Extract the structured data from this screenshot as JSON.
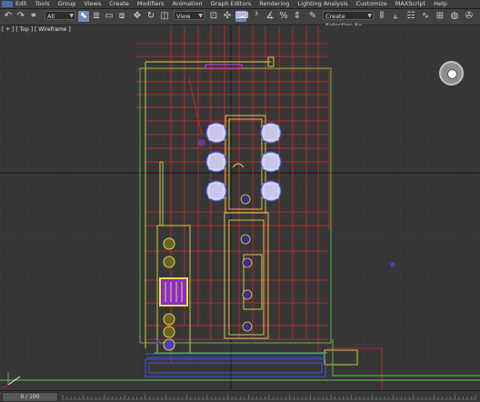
{
  "menu": {
    "items": [
      "Edit",
      "Tools",
      "Group",
      "Views",
      "Create",
      "Modifiers",
      "Animation",
      "Graph Editors",
      "Rendering",
      "Lighting Analysis",
      "Customize",
      "MAXScript",
      "Help"
    ]
  },
  "toolbar": {
    "filter_value": "All",
    "coord_value": "View",
    "selection_set_placeholder": "Create Selection Se"
  },
  "viewport": {
    "label": "[ + ] [ Top ] [ Wireframe ]"
  },
  "statusbar": {
    "frame_counter": "0 / 100"
  },
  "icons": {
    "viewcube": "viewcube-icon",
    "axis": "axis-gizmo-icon"
  },
  "colors": {
    "grid_bg": "#363636",
    "grid_line": "#444444",
    "grid_major": "#1e1e1e",
    "red": "#d42a2a",
    "yellow": "#e1d64a",
    "blue": "#3a55d8",
    "purple": "#8d2bd9",
    "green": "#5ec94f"
  }
}
